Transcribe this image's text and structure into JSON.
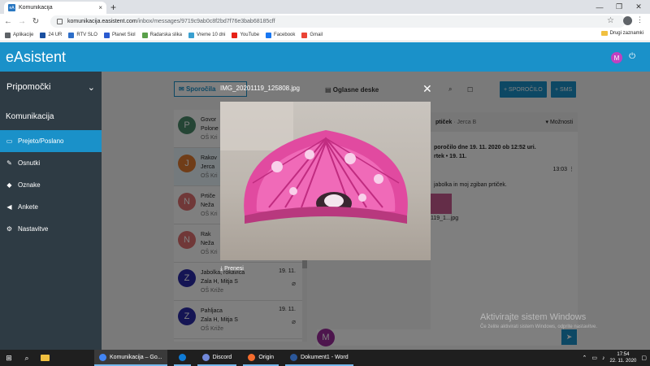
{
  "browser": {
    "tab_title": "Komunikacija",
    "favicon_text": "eA",
    "url_host": "komunikacija.easistent.com",
    "url_path": "/inbox/messages/9719c9ab0c8f2bd7f76e3bab68185cff",
    "bookmarks": [
      {
        "label": "Aplikacije",
        "color": "#5f6368"
      },
      {
        "label": "24 UR",
        "color": "#1a4fa0"
      },
      {
        "label": "RTV SLO",
        "color": "#2d6ec8"
      },
      {
        "label": "Planet Siol",
        "color": "#2a5bd0"
      },
      {
        "label": "Radarska slika",
        "color": "#5aa04a"
      },
      {
        "label": "Vreme 10 dni",
        "color": "#3aa0d0"
      },
      {
        "label": "YouTube",
        "color": "#e62117"
      },
      {
        "label": "Facebook",
        "color": "#1877f2"
      },
      {
        "label": "Gmail",
        "color": "#ea4335"
      }
    ],
    "other_bookmarks": "Drugi zaznamki"
  },
  "app": {
    "brand": "eAsistent",
    "user_initial": "M"
  },
  "sidebar": {
    "header": "Pripomočki",
    "section": "Komunikacija",
    "items": [
      {
        "label": "Prejeto/Poslano",
        "icon": "inbox-icon"
      },
      {
        "label": "Osnutki",
        "icon": "pencil-icon"
      },
      {
        "label": "Oznake",
        "icon": "tag-icon"
      },
      {
        "label": "Ankete",
        "icon": "megaphone-icon"
      },
      {
        "label": "Nastavitve",
        "icon": "gear-icon"
      }
    ]
  },
  "toolbar": {
    "messages_tab": "Sporočila",
    "boards_tab": "Oglasne deske",
    "new_message": "SPOROČILO",
    "sms": "SMS"
  },
  "messages": [
    {
      "initial": "P",
      "color": "#4a8a6a",
      "l1": "Govor",
      "l2": "Polone",
      "l3": "OŠ Kri",
      "date": "",
      "clip": false
    },
    {
      "initial": "J",
      "color": "#e07a30",
      "l1": "Rakov",
      "l2": "Jerca",
      "l3": "OŠ Kri",
      "date": "",
      "clip": false
    },
    {
      "initial": "N",
      "color": "#e07070",
      "l1": "Prtiče",
      "l2": "Neža",
      "l3": "OŠ Kri",
      "date": "",
      "clip": false
    },
    {
      "initial": "N",
      "color": "#e07070",
      "l1": "Rak",
      "l2": "Neža",
      "l3": "OŠ Kri",
      "date": "",
      "clip": false
    },
    {
      "initial": "Z",
      "color": "#2b2ba8",
      "l1": "Jabolka, rokavica",
      "l2": "Zala H, Mitja S",
      "l3": "OŠ Križe",
      "date": "19. 11.",
      "clip": true
    },
    {
      "initial": "Z",
      "color": "#2b2ba8",
      "l1": "Pahljaca",
      "l2": "Zala H, Mitja S",
      "l3": "OŠ Križe",
      "date": "19. 11.",
      "clip": true
    }
  ],
  "detail": {
    "header_title": "ptiček",
    "header_from": "· Jerca B",
    "options": "Možnosti",
    "meta1": "poročilo dne 19. 11. 2020 ob 12:52 uri.",
    "meta2": "rtek • 19. 11.",
    "time": "13:03",
    "body": "jabolka in moj zgiban prtiček.",
    "attachment": "119_1...jpg"
  },
  "compose_initial": "M",
  "modal": {
    "filename": "IMG_20201119_125808.jpg",
    "download": "Prenesi"
  },
  "watermark": {
    "line1": "Aktivirajte sistem Windows",
    "line2": "Če želite aktivirati sistem Windows, odprite nastavitve."
  },
  "taskbar": {
    "apps": [
      {
        "label": "Komunikacija – Go...",
        "color": "#4285f4",
        "active": true
      },
      {
        "label": "",
        "color": "#0f7bd6",
        "active": false
      },
      {
        "label": "Discord",
        "color": "#7289da",
        "active": false
      },
      {
        "label": "Origin",
        "color": "#f56c2d",
        "active": false
      },
      {
        "label": "Dokument1 - Word",
        "color": "#2b579a",
        "active": false
      }
    ],
    "time": "17:54",
    "date": "22. 11. 2020"
  }
}
